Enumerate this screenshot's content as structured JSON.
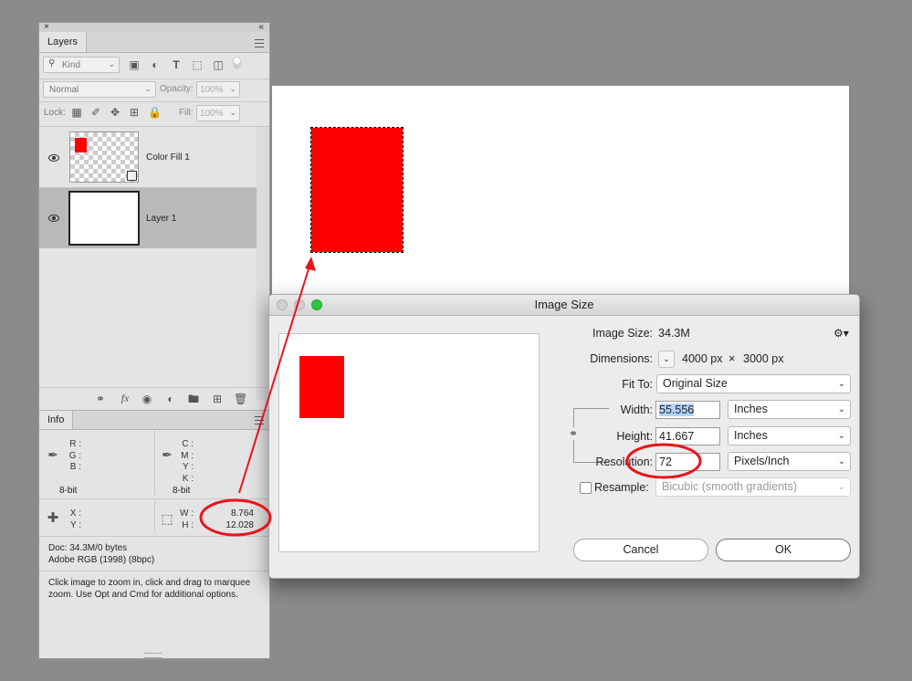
{
  "layers_panel": {
    "close_glyph": "×",
    "collapse_glyph": "«",
    "tab": "Layers",
    "filter_kind": "Kind",
    "blend_mode": "Normal",
    "opacity_label": "Opacity:",
    "opacity_value": "100%",
    "lock_label": "Lock:",
    "fill_label": "Fill:",
    "fill_value": "100%",
    "layers": [
      {
        "name": "Color Fill 1"
      },
      {
        "name": "Layer 1"
      }
    ],
    "footer_icons": [
      "link-icon",
      "fx-icon",
      "mask-icon",
      "adjustment-icon",
      "folder-icon",
      "new-layer-icon",
      "trash-icon"
    ]
  },
  "info_panel": {
    "tab": "Info",
    "rgb_labels": [
      "R :",
      "G :",
      "B :"
    ],
    "cmyk_labels": [
      "C :",
      "M :",
      "Y :",
      "K :"
    ],
    "bit_left": "8-bit",
    "bit_right": "8-bit",
    "xy_labels": [
      "X :",
      "Y :"
    ],
    "wh_labels": [
      "W :",
      "H :"
    ],
    "width_value": "8.764",
    "height_value": "12.028",
    "doc_line": "Doc: 34.3M/0 bytes",
    "profile_line": "Adobe RGB (1998) (8bpc)",
    "hint_text": "Click image to zoom in, click and drag to marquee zoom.  Use Opt and Cmd for additional options."
  },
  "dialog": {
    "title": "Image Size",
    "image_size_label": "Image Size:",
    "image_size_value": "34.3M",
    "dimensions_label": "Dimensions:",
    "dimensions_w": "4000 px",
    "dimensions_x": "×",
    "dimensions_h": "3000 px",
    "fit_to_label": "Fit To:",
    "fit_to_value": "Original Size",
    "width_label": "Width:",
    "width_value": "55.556",
    "width_unit": "Inches",
    "height_label": "Height:",
    "height_value": "41.667",
    "height_unit": "Inches",
    "resolution_label": "Resolution:",
    "resolution_value": "72",
    "resolution_unit": "Pixels/Inch",
    "resample_label": "Resample:",
    "resample_value": "Bicubic (smooth gradients)",
    "cancel": "Cancel",
    "ok": "OK"
  },
  "colors": {
    "fill_red": "#ff0000",
    "annotation_red": "#e8151b",
    "selection_blue": "#b3d4fc"
  }
}
